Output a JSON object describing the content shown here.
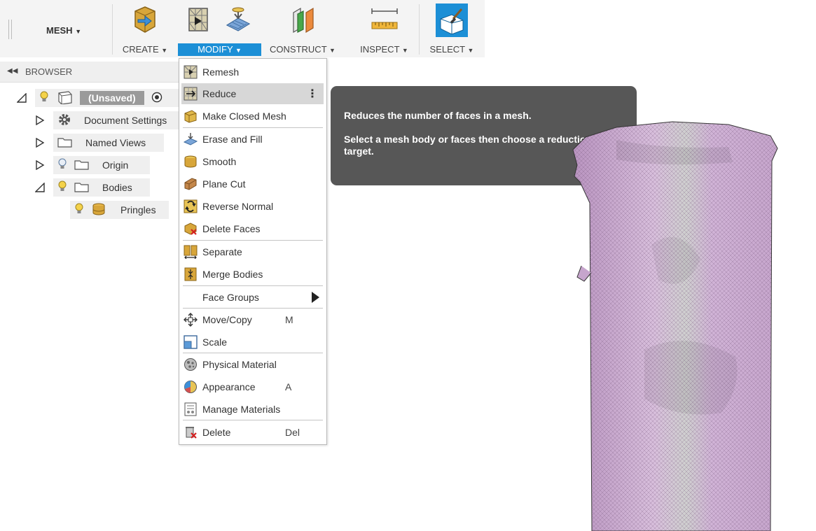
{
  "toolbar": {
    "workspace": "MESH",
    "groups": [
      {
        "label": "CREATE"
      },
      {
        "label": "MODIFY"
      },
      {
        "label": "CONSTRUCT"
      },
      {
        "label": "INSPECT"
      },
      {
        "label": "SELECT"
      }
    ],
    "active_color": "#1c8fd6"
  },
  "browser": {
    "title": "BROWSER",
    "items": [
      {
        "label": "(Unsaved)"
      },
      {
        "label": "Document Settings"
      },
      {
        "label": "Named Views"
      },
      {
        "label": "Origin"
      },
      {
        "label": "Bodies"
      },
      {
        "label": "Pringles"
      }
    ]
  },
  "menu": {
    "items": [
      {
        "label": "Remesh",
        "icon": "remesh-icon"
      },
      {
        "label": "Reduce",
        "icon": "reduce-icon"
      },
      {
        "label": "Make Closed Mesh",
        "icon": "make-closed-mesh-icon"
      },
      {
        "label": "Erase and Fill",
        "icon": "erase-fill-icon"
      },
      {
        "label": "Smooth",
        "icon": "smooth-icon"
      },
      {
        "label": "Plane Cut",
        "icon": "plane-cut-icon"
      },
      {
        "label": "Reverse Normal",
        "icon": "reverse-normal-icon"
      },
      {
        "label": "Delete Faces",
        "icon": "delete-faces-icon"
      },
      {
        "label": "Separate",
        "icon": "separate-icon"
      },
      {
        "label": "Merge Bodies",
        "icon": "merge-bodies-icon"
      },
      {
        "label": "Face Groups",
        "icon": ""
      },
      {
        "label": "Move/Copy",
        "icon": "move-copy-icon",
        "shortcut": "M"
      },
      {
        "label": "Scale",
        "icon": "scale-icon"
      },
      {
        "label": "Physical Material",
        "icon": "physical-material-icon"
      },
      {
        "label": "Appearance",
        "icon": "appearance-icon",
        "shortcut": "A"
      },
      {
        "label": "Manage Materials",
        "icon": "manage-materials-icon"
      },
      {
        "label": "Delete",
        "icon": "delete-icon",
        "shortcut": "Del"
      }
    ]
  },
  "tooltip": {
    "line1": "Reduces the number of faces in a mesh.",
    "line2": "Select a mesh body or faces then choose a reduction target."
  },
  "colors": {
    "mesh": "#c9a7cf",
    "tooltip_bg": "#575757",
    "highlight": "#d7d7d7"
  }
}
